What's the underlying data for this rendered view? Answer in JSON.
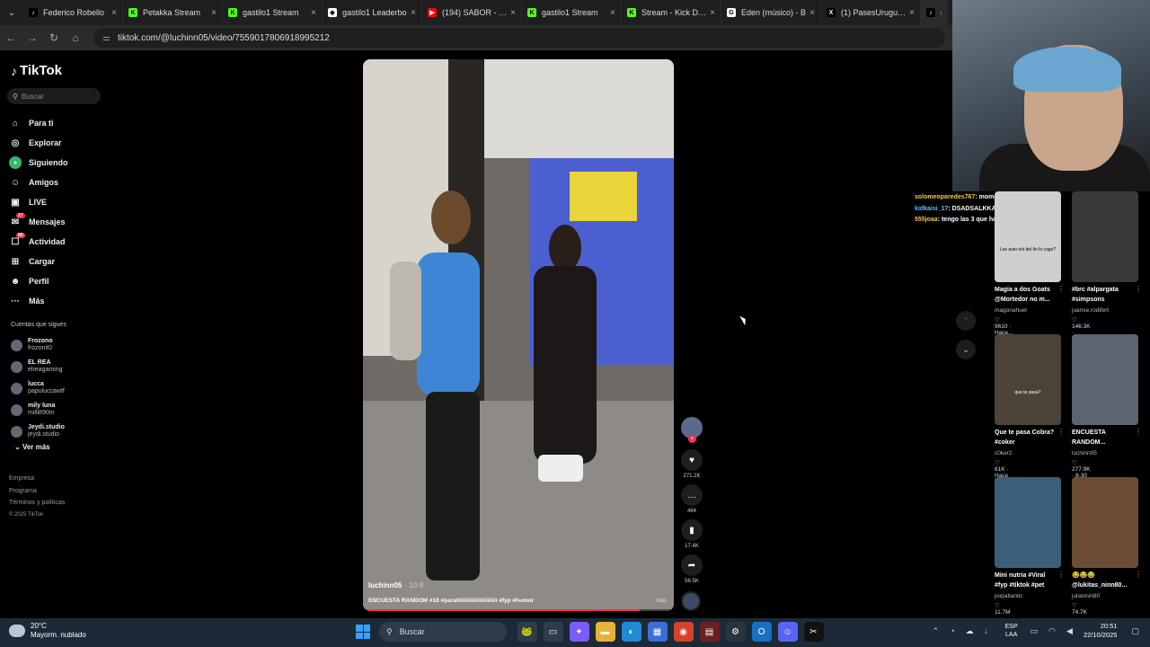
{
  "browser": {
    "tabs": [
      {
        "title": "Federico Robello",
        "favicon": "tiktok-icon",
        "color": "#000000",
        "glyph": "♪"
      },
      {
        "title": "Petakka Stream",
        "favicon": "kick-icon",
        "color": "#53fc18",
        "glyph": "K"
      },
      {
        "title": "gastilo1 Stream",
        "favicon": "kick-icon",
        "color": "#53fc18",
        "glyph": "K"
      },
      {
        "title": "gastilo1 Leaderbo",
        "favicon": "leaderboard-icon",
        "color": "#ffffff",
        "glyph": "◆"
      },
      {
        "title": "(194) SABOR - Kh",
        "favicon": "youtube-icon",
        "color": "#ff0000",
        "glyph": "▶"
      },
      {
        "title": "gastilo1 Stream",
        "favicon": "kick-icon",
        "color": "#53fc18",
        "glyph": "K"
      },
      {
        "title": "Stream - Kick Das",
        "favicon": "kick-icon",
        "color": "#53fc18",
        "glyph": "K"
      },
      {
        "title": "Eden (músico) - B",
        "favicon": "google-icon",
        "color": "#ffffff",
        "glyph": "G"
      },
      {
        "title": "(1) PasesUruguay",
        "favicon": "x-icon",
        "color": "#000000",
        "glyph": "X"
      },
      {
        "title": "(27)",
        "favicon": "tiktok-icon",
        "color": "#000000",
        "glyph": "♪"
      }
    ],
    "url": "tiktok.com/@luchinn05/video/7559017806918995212"
  },
  "sidebar": {
    "logo": "TikTok",
    "search_placeholder": "Buscar",
    "menu": [
      {
        "label": "Para ti",
        "icon": "home-icon",
        "glyph": "⌂"
      },
      {
        "label": "Explorar",
        "icon": "compass-icon",
        "glyph": "◎"
      },
      {
        "label": "Siguiendo",
        "icon": "following-icon",
        "glyph": "●"
      },
      {
        "label": "Amigos",
        "icon": "friends-icon",
        "glyph": "☺"
      },
      {
        "label": "LIVE",
        "icon": "live-icon",
        "glyph": "▣"
      },
      {
        "label": "Mensajes",
        "icon": "messages-icon",
        "glyph": "✉",
        "badge": "17"
      },
      {
        "label": "Actividad",
        "icon": "activity-icon",
        "glyph": "☐",
        "badge": "99"
      },
      {
        "label": "Cargar",
        "icon": "upload-icon",
        "glyph": "⊞"
      },
      {
        "label": "Perfil",
        "icon": "profile-icon",
        "glyph": "☻"
      },
      {
        "label": "Más",
        "icon": "more-icon",
        "glyph": "···"
      }
    ],
    "following_title": "Cuentas que sigues",
    "following": [
      {
        "name": "Frozono",
        "handle": "frozonit0"
      },
      {
        "name": "EL REA",
        "handle": "elreagaming"
      },
      {
        "name": "lucca",
        "handle": "papuluccawtf"
      },
      {
        "name": "mily luna",
        "handle": "milli890m"
      },
      {
        "name": "Jeydi.studio",
        "handle": "jeydi.studio"
      }
    ],
    "see_more": "Ver más",
    "footer": [
      "Empresa",
      "Programa",
      "Términos y políticas",
      "© 2025 TikTok"
    ]
  },
  "video": {
    "username": "luchinn05",
    "date": "· 10-8",
    "caption": "ENCUESTA RANDOM #16 #paratiiiiiiiiiiiiiiiiiiiiiiii #fyp #humor",
    "more": "más",
    "progress": 0.89,
    "likes": "271.2K",
    "comments": "464",
    "saves": "17.4K",
    "shares": "56.5K"
  },
  "chat": [
    {
      "user": "solomeoparedes767",
      "msg": "momo hablas mucho"
    },
    {
      "user": "kidkaisi_17",
      "msg": "DSADSALKKASHDLKASJD"
    },
    {
      "user": "555joaa",
      "msg": "tengo las 3 que hago?"
    }
  ],
  "recommended": [
    {
      "title": "Magia a dos Goats @Mortedor no m...",
      "author": "magonahuel",
      "stats": "♡ 9610 · Hace...",
      "color": "#cfcfcf",
      "label": "Los auto-chi del fin lo cago?"
    },
    {
      "title": "#brc #alpargata #simpsons",
      "author": "juanse.rodifert",
      "stats": "♡ 146.3K · Hace...",
      "color": "#3a3a3a",
      "label": ""
    },
    {
      "title": "Que te pasa Cobra? #coker",
      "author": "c0ker2",
      "stats": "♡ 61K · Hace 6 día(s)",
      "color": "#4c4238",
      "label": "que te pasa?"
    },
    {
      "title": "ENCUESTA RANDOM...",
      "author": "luchinn05",
      "stats": "♡ 277.9K · 8-30",
      "color": "#5c6470",
      "label": ""
    },
    {
      "title": "Mini nutria #Viral #fyp #tiktok #pet",
      "author": "popatlantic",
      "stats": "♡ 11.7M · Hace...",
      "color": "#3b5f7a",
      "label": ""
    },
    {
      "title": "😂😂😂 @lukitas_ninn80...",
      "author": "juliannin80",
      "stats": "♡ 74.7K · Hace...",
      "color": "#6b4e35",
      "label": ""
    }
  ],
  "taskbar": {
    "temp": "20°C",
    "weather": "Mayorm. nublado",
    "search": "Buscar",
    "apps": [
      {
        "icon": "search-app-icon",
        "glyph": "🐸",
        "color": "#2d3b4a"
      },
      {
        "icon": "taskview-icon",
        "glyph": "▭",
        "color": "#2d3b4a"
      },
      {
        "icon": "copilot-icon",
        "glyph": "✦",
        "color": "#7a5cff"
      },
      {
        "icon": "file-explorer-icon",
        "glyph": "▬",
        "color": "#e8b23a"
      },
      {
        "icon": "edge-icon",
        "glyph": "◐",
        "color": "#1f8ad6"
      },
      {
        "icon": "store-icon",
        "glyph": "▦",
        "color": "#3b6fd6"
      },
      {
        "icon": "chrome-icon",
        "glyph": "◉",
        "color": "#d9402b"
      },
      {
        "icon": "recorder-icon",
        "glyph": "▤",
        "color": "#6b2020"
      },
      {
        "icon": "steam-icon",
        "glyph": "⚙",
        "color": "#2a3440"
      },
      {
        "icon": "outlook-icon",
        "glyph": "O",
        "color": "#1a6fc4"
      },
      {
        "icon": "discord-icon",
        "glyph": "☺",
        "color": "#5865f2"
      },
      {
        "icon": "capcut-icon",
        "glyph": "✂",
        "color": "#111111"
      }
    ],
    "lang": "ESP",
    "lang2": "LAA",
    "time": "20:51",
    "date": "22/10/2025"
  }
}
